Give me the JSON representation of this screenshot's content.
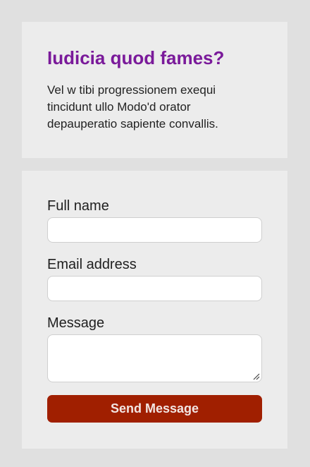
{
  "intro": {
    "title": "Iudicia quod fames?",
    "text": "Vel w tibi progressionem exequi tincidunt ullo Modo'd orator depauperatio sapiente convallis."
  },
  "form": {
    "name_label": "Full name",
    "name_value": "",
    "email_label": "Email address",
    "email_value": "",
    "message_label": "Message",
    "message_value": "",
    "submit_label": "Send Message"
  },
  "colors": {
    "page_background": "#e0e0e0",
    "card_background": "#ececec",
    "title": "#7a1a9a",
    "button": "#a01f00",
    "button_text": "#f2e6e3"
  },
  "icons": {
    "textarea_resize": "resize-grip-icon"
  }
}
